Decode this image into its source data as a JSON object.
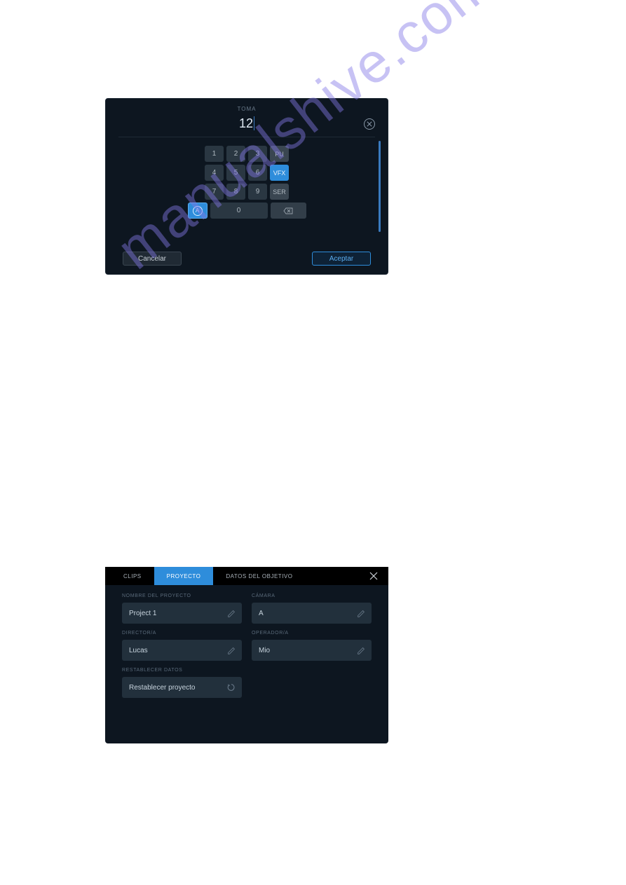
{
  "watermark": "manualshive.com",
  "toma": {
    "label": "TOMA",
    "value": "12",
    "keys": {
      "r1": [
        "1",
        "2",
        "3"
      ],
      "r1tag": "PU",
      "r2": [
        "4",
        "5",
        "6"
      ],
      "r2tag": "VFX",
      "r3": [
        "7",
        "8",
        "9"
      ],
      "r3tag": "SER",
      "auto": "A",
      "zero": "0"
    },
    "cancel": "Cancelar",
    "accept": "Aceptar"
  },
  "project": {
    "tabs": [
      "CLIPS",
      "PROYECTO",
      "DATOS DEL OBJETIVO"
    ],
    "fields": {
      "project_name": {
        "label": "NOMBRE DEL PROYECTO",
        "value": "Project 1"
      },
      "camera": {
        "label": "CÁMARA",
        "value": "A"
      },
      "director": {
        "label": "DIRECTOR/A",
        "value": "Lucas"
      },
      "operator": {
        "label": "OPERADOR/A",
        "value": "Mio"
      },
      "reset": {
        "label": "RESTABLECER DATOS",
        "value": "Restablecer proyecto"
      }
    }
  }
}
